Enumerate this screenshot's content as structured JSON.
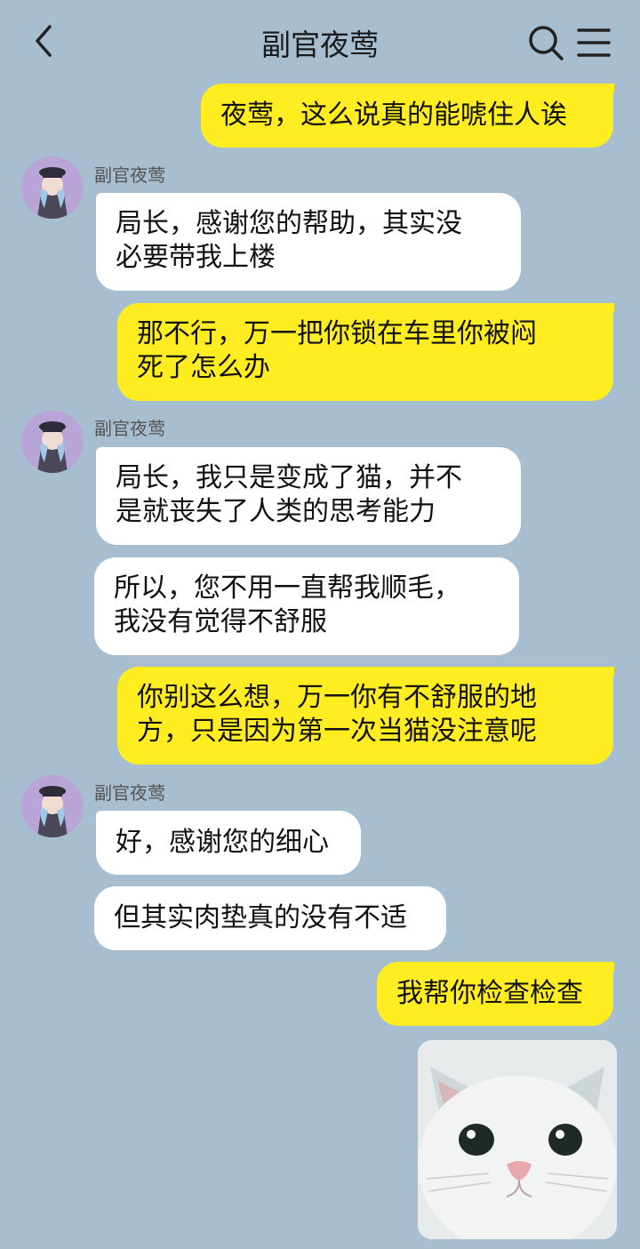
{
  "header": {
    "title": "副官夜莺",
    "back_icon": "chevron-left-icon",
    "search_icon": "search-icon",
    "menu_icon": "menu-icon"
  },
  "colors": {
    "background": "#a7bdd0",
    "my_bubble": "#ffed21",
    "their_bubble": "#ffffff"
  },
  "messages": {
    "m1": {
      "from": "me",
      "text": "夜莺，这么说真的能唬住人诶"
    },
    "g1": {
      "sender": "副官夜莺"
    },
    "m2": {
      "from": "副官夜莺",
      "lines": [
        "局长，感谢您的帮助，其实没",
        "必要带我上楼"
      ]
    },
    "m3": {
      "from": "me",
      "lines": [
        "那不行，万一把你锁在车里你被闷",
        "死了怎么办"
      ]
    },
    "g2": {
      "sender": "副官夜莺"
    },
    "m4": {
      "from": "副官夜莺",
      "lines": [
        "局长，我只是变成了猫，并不",
        "是就丧失了人类的思考能力"
      ]
    },
    "m5": {
      "from": "副官夜莺",
      "lines": [
        "所以，您不用一直帮我顺毛，",
        "我没有觉得不舒服"
      ]
    },
    "m6": {
      "from": "me",
      "lines": [
        "你别这么想，万一你有不舒服的地",
        "方，只是因为第一次当猫没注意呢"
      ]
    },
    "g3": {
      "sender": "副官夜莺"
    },
    "m7": {
      "from": "副官夜莺",
      "text": "好，感谢您的细心"
    },
    "m8": {
      "from": "副官夜莺",
      "text": "但其实肉垫真的没有不适"
    },
    "m9": {
      "from": "me",
      "text": "我帮你检查检查"
    },
    "m10": {
      "from": "me",
      "image": "white-cat-photo"
    }
  }
}
